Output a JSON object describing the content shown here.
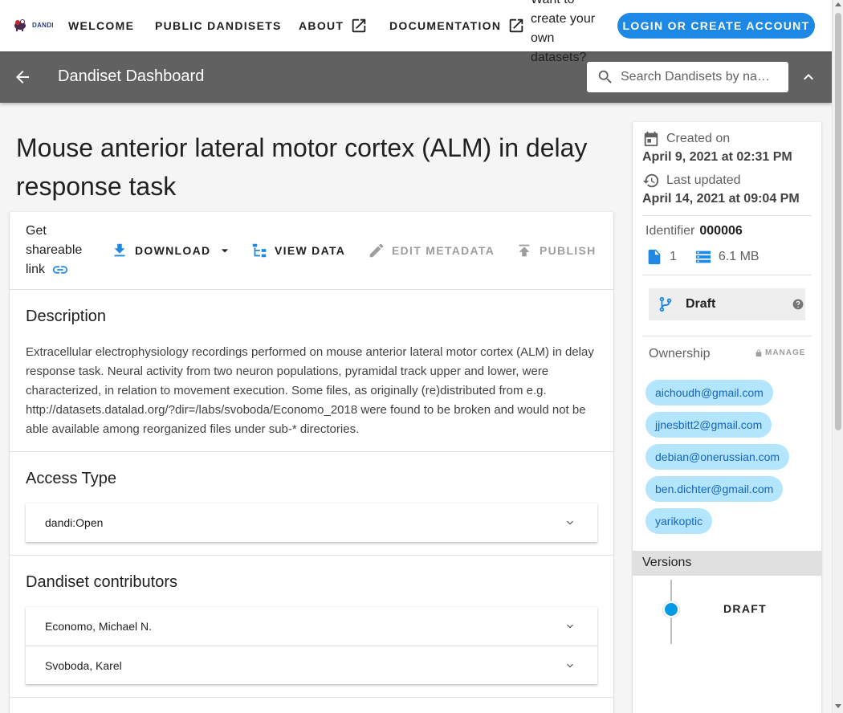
{
  "nav": {
    "logo_text": "DANDI",
    "links": [
      "WELCOME",
      "PUBLIC DANDISETS",
      "ABOUT",
      "DOCUMENTATION"
    ],
    "promo": "Want to create your own datasets?",
    "login_label": "LOGIN OR CREATE ACCOUNT"
  },
  "dashbar": {
    "title": "Dandiset Dashboard",
    "search_placeholder": "Search Dandisets by na…"
  },
  "dandiset": {
    "title": "Mouse anterior lateral motor cortex (ALM) in delay response task",
    "toolbar": {
      "share_label": "Get shareable link",
      "download_label": "DOWNLOAD",
      "view_data_label": "VIEW DATA",
      "edit_metadata_label": "EDIT METADATA",
      "publish_label": "PUBLISH"
    },
    "description_title": "Description",
    "description": "Extracellular electrophysiology recordings performed on mouse anterior lateral motor cortex (ALM) in delay response task. Neural activity from two neuron populations, pyramidal track upper and lower, were characterized, in relation to movement execution. Some files, as originally (re)distributed from e.g. http://datasets.datalad.org/?dir=/labs/svoboda/Economo_2018 were found to be broken and would not be able available among reorganized files under sub-* directories.",
    "access_title": "Access Type",
    "access_value": "dandi:Open",
    "contributors_title": "Dandiset contributors",
    "contributors": [
      "Economo, Michael N.",
      "Svoboda, Karel"
    ]
  },
  "sidebar": {
    "created_label": "Created on",
    "created_value": "April 9, 2021 at 02:31 PM",
    "updated_label": "Last updated",
    "updated_value": "April 14, 2021 at 09:04 PM",
    "identifier_label": "Identifier",
    "identifier_value": "000006",
    "file_count": "1",
    "size": "6.1 MB",
    "status": "Draft",
    "ownership_label": "Ownership",
    "manage_label": "MANAGE",
    "owners": [
      "aichoudh@gmail.com",
      "jjnesbitt2@gmail.com",
      "debian@onerussian.com",
      "ben.dichter@gmail.com",
      "yarikoptic"
    ],
    "versions_label": "Versions",
    "version_name": "DRAFT"
  },
  "colors": {
    "accent": "#1e88e5",
    "chip_bg": "#b3e5fc",
    "chip_text": "#1565c0",
    "dashbar_bg": "#616161",
    "timeline_dot": "#039be5"
  }
}
